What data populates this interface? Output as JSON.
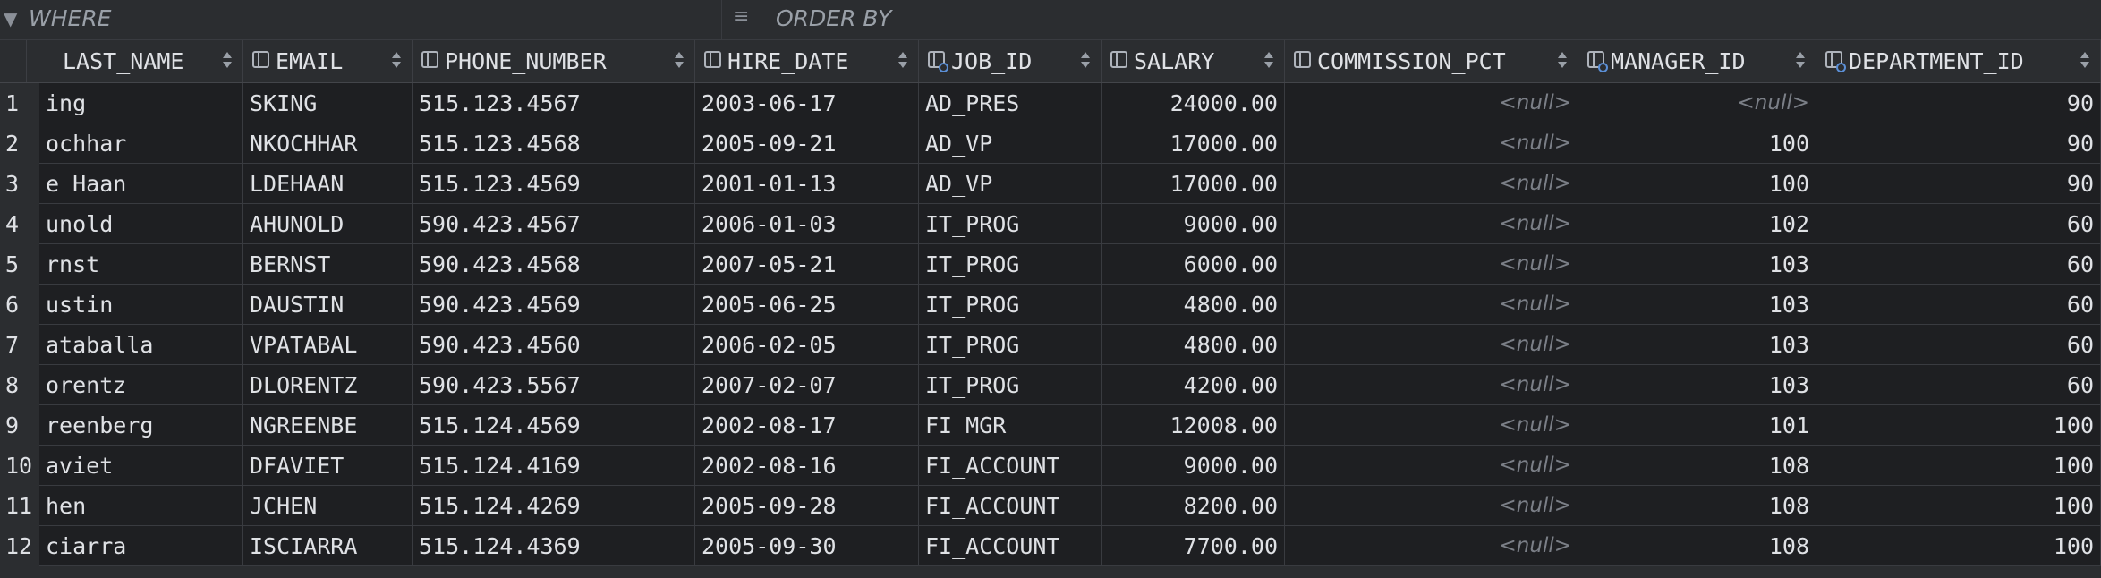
{
  "filter": {
    "where_label": "WHERE",
    "orderby_label": "ORDER BY"
  },
  "columns": [
    {
      "key": "last_name",
      "label": "LAST_NAME"
    },
    {
      "key": "email",
      "label": "EMAIL"
    },
    {
      "key": "phone_number",
      "label": "PHONE_NUMBER"
    },
    {
      "key": "hire_date",
      "label": "HIRE_DATE"
    },
    {
      "key": "job_id",
      "label": "JOB_ID"
    },
    {
      "key": "salary",
      "label": "SALARY"
    },
    {
      "key": "commission_pct",
      "label": "COMMISSION_PCT"
    },
    {
      "key": "manager_id",
      "label": "MANAGER_ID"
    },
    {
      "key": "department_id",
      "label": "DEPARTMENT_ID"
    }
  ],
  "rows": [
    {
      "n": "1",
      "last_name": "ing",
      "email": "SKING",
      "phone_number": "515.123.4567",
      "hire_date": "2003-06-17",
      "job_id": "AD_PRES",
      "salary": "24000.00",
      "commission_pct": "<null>",
      "manager_id": "<null>",
      "department_id": "90"
    },
    {
      "n": "2",
      "last_name": "ochhar",
      "email": "NKOCHHAR",
      "phone_number": "515.123.4568",
      "hire_date": "2005-09-21",
      "job_id": "AD_VP",
      "salary": "17000.00",
      "commission_pct": "<null>",
      "manager_id": "100",
      "department_id": "90"
    },
    {
      "n": "3",
      "last_name": "e Haan",
      "email": "LDEHAAN",
      "phone_number": "515.123.4569",
      "hire_date": "2001-01-13",
      "job_id": "AD_VP",
      "salary": "17000.00",
      "commission_pct": "<null>",
      "manager_id": "100",
      "department_id": "90"
    },
    {
      "n": "4",
      "last_name": "unold",
      "email": "AHUNOLD",
      "phone_number": "590.423.4567",
      "hire_date": "2006-01-03",
      "job_id": "IT_PROG",
      "salary": "9000.00",
      "commission_pct": "<null>",
      "manager_id": "102",
      "department_id": "60"
    },
    {
      "n": "5",
      "last_name": "rnst",
      "email": "BERNST",
      "phone_number": "590.423.4568",
      "hire_date": "2007-05-21",
      "job_id": "IT_PROG",
      "salary": "6000.00",
      "commission_pct": "<null>",
      "manager_id": "103",
      "department_id": "60"
    },
    {
      "n": "6",
      "last_name": "ustin",
      "email": "DAUSTIN",
      "phone_number": "590.423.4569",
      "hire_date": "2005-06-25",
      "job_id": "IT_PROG",
      "salary": "4800.00",
      "commission_pct": "<null>",
      "manager_id": "103",
      "department_id": "60"
    },
    {
      "n": "7",
      "last_name": "ataballa",
      "email": "VPATABAL",
      "phone_number": "590.423.4560",
      "hire_date": "2006-02-05",
      "job_id": "IT_PROG",
      "salary": "4800.00",
      "commission_pct": "<null>",
      "manager_id": "103",
      "department_id": "60"
    },
    {
      "n": "8",
      "last_name": "orentz",
      "email": "DLORENTZ",
      "phone_number": "590.423.5567",
      "hire_date": "2007-02-07",
      "job_id": "IT_PROG",
      "salary": "4200.00",
      "commission_pct": "<null>",
      "manager_id": "103",
      "department_id": "60"
    },
    {
      "n": "9",
      "last_name": "reenberg",
      "email": "NGREENBE",
      "phone_number": "515.124.4569",
      "hire_date": "2002-08-17",
      "job_id": "FI_MGR",
      "salary": "12008.00",
      "commission_pct": "<null>",
      "manager_id": "101",
      "department_id": "100"
    },
    {
      "n": "10",
      "last_name": "aviet",
      "email": "DFAVIET",
      "phone_number": "515.124.4169",
      "hire_date": "2002-08-16",
      "job_id": "FI_ACCOUNT",
      "salary": "9000.00",
      "commission_pct": "<null>",
      "manager_id": "108",
      "department_id": "100"
    },
    {
      "n": "11",
      "last_name": "hen",
      "email": "JCHEN",
      "phone_number": "515.124.4269",
      "hire_date": "2005-09-28",
      "job_id": "FI_ACCOUNT",
      "salary": "8200.00",
      "commission_pct": "<null>",
      "manager_id": "108",
      "department_id": "100"
    },
    {
      "n": "12",
      "last_name": "ciarra",
      "email": "ISCIARRA",
      "phone_number": "515.124.4369",
      "hire_date": "2005-09-30",
      "job_id": "FI_ACCOUNT",
      "salary": "7700.00",
      "commission_pct": "<null>",
      "manager_id": "108",
      "department_id": "100"
    }
  ]
}
